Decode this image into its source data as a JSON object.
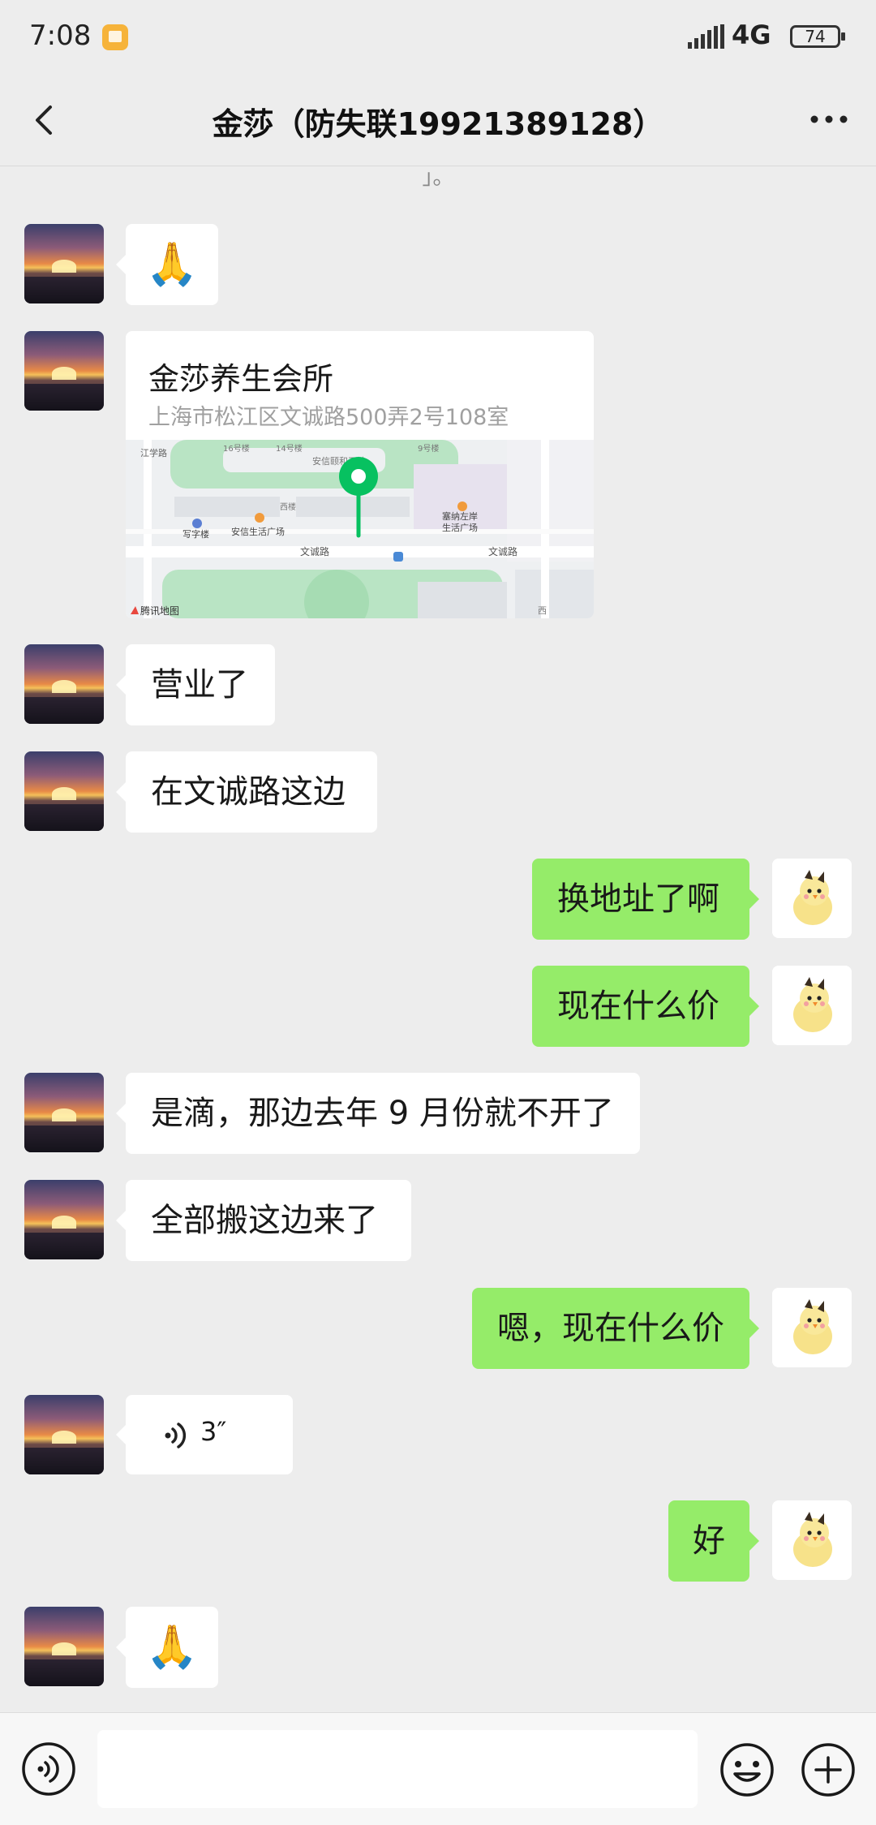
{
  "status": {
    "time": "7:08",
    "network": "4G",
    "battery": "74"
  },
  "header": {
    "title": "金莎（防失联19921389128）"
  },
  "cut_text": "」。",
  "location": {
    "name": "金莎养生会所",
    "address": "上海市松江区文诚路500弄2号108室",
    "map_labels": {
      "road1": "文诚路",
      "road2": "文诚路",
      "poi1": "安信生活广场",
      "poi2": "塞纳左岸",
      "poi3": "生活广场",
      "poi4": "写字楼",
      "poi5": "江学路",
      "poi6": "16号楼",
      "poi7": "14号楼",
      "poi8": "9号楼",
      "poi9": "安信颐和天地",
      "poi10": "西楼",
      "poi11": "西",
      "brand": "腾讯地图"
    }
  },
  "messages": {
    "m1": "🙏",
    "m3": "营业了",
    "m4": "在文诚路这边",
    "m5": "换地址了啊",
    "m6": "现在什么价",
    "m7": "是滴，那边去年 9 月份就不开了",
    "m8": "全部搬这边来了",
    "m9": "嗯，现在什么价",
    "m10_voice": "3″",
    "m11": "好",
    "m12": "🙏"
  },
  "input": {
    "placeholder": ""
  },
  "colors": {
    "background": "#ededed",
    "my_bubble": "#95ec69",
    "their_bubble": "#ffffff",
    "map_pin": "#07c160"
  },
  "icons": {
    "back": "chevron-left-icon",
    "more": "more-dots-icon",
    "voice": "voice-icon",
    "emoji": "emoji-icon",
    "plus": "plus-icon"
  }
}
